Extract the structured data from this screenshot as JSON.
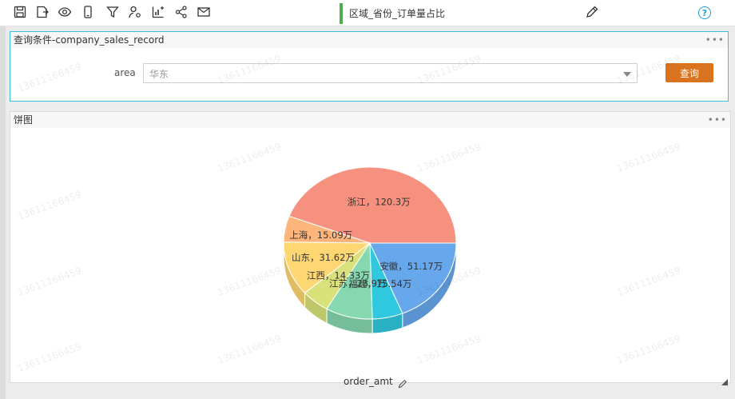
{
  "toolbar": {
    "icons": [
      "save-icon",
      "save-as-icon",
      "preview-icon",
      "mobile-icon",
      "filter-icon",
      "user-settings-icon",
      "chart-add-icon",
      "share-icon",
      "mail-icon"
    ]
  },
  "document": {
    "title": "区域_省份_订单量占比"
  },
  "query_panel": {
    "title": "查询条件-company_sales_record",
    "area_label": "area",
    "area_value": "华东",
    "query_button": "查询"
  },
  "chart_panel": {
    "title": "饼图",
    "measure_label": "order_amt"
  },
  "watermark": "13611166459",
  "colors": {
    "accent": "#3cc0d8",
    "query_button": "#d9731f",
    "title_marker": "#4cae4c"
  },
  "chart_data": {
    "type": "pie",
    "title": "",
    "measure": "order_amt",
    "slices": [
      {
        "name": "浙江",
        "value": 120.3,
        "label": "浙江，120.3万",
        "color": "#f6907f"
      },
      {
        "name": "上海",
        "value": 15.09,
        "label": "上海，15.09万",
        "color": "#fdb57c"
      },
      {
        "name": "山东",
        "value": 31.62,
        "label": "山东，31.62万",
        "color": "#fed772"
      },
      {
        "name": "江西",
        "value": 14.33,
        "label": "江西，14.33万",
        "color": "#d9e27a"
      },
      {
        "name": "江苏",
        "value": 23.9,
        "label": "江苏，23.9万",
        "color": "#86d8b0"
      },
      {
        "name": "福建",
        "value": 15.54,
        "label": "福建，15.54万",
        "color": "#2fc8de"
      },
      {
        "name": "安徽",
        "value": 51.17,
        "label": "安徽，51.17万",
        "color": "#67a7ec"
      }
    ]
  }
}
